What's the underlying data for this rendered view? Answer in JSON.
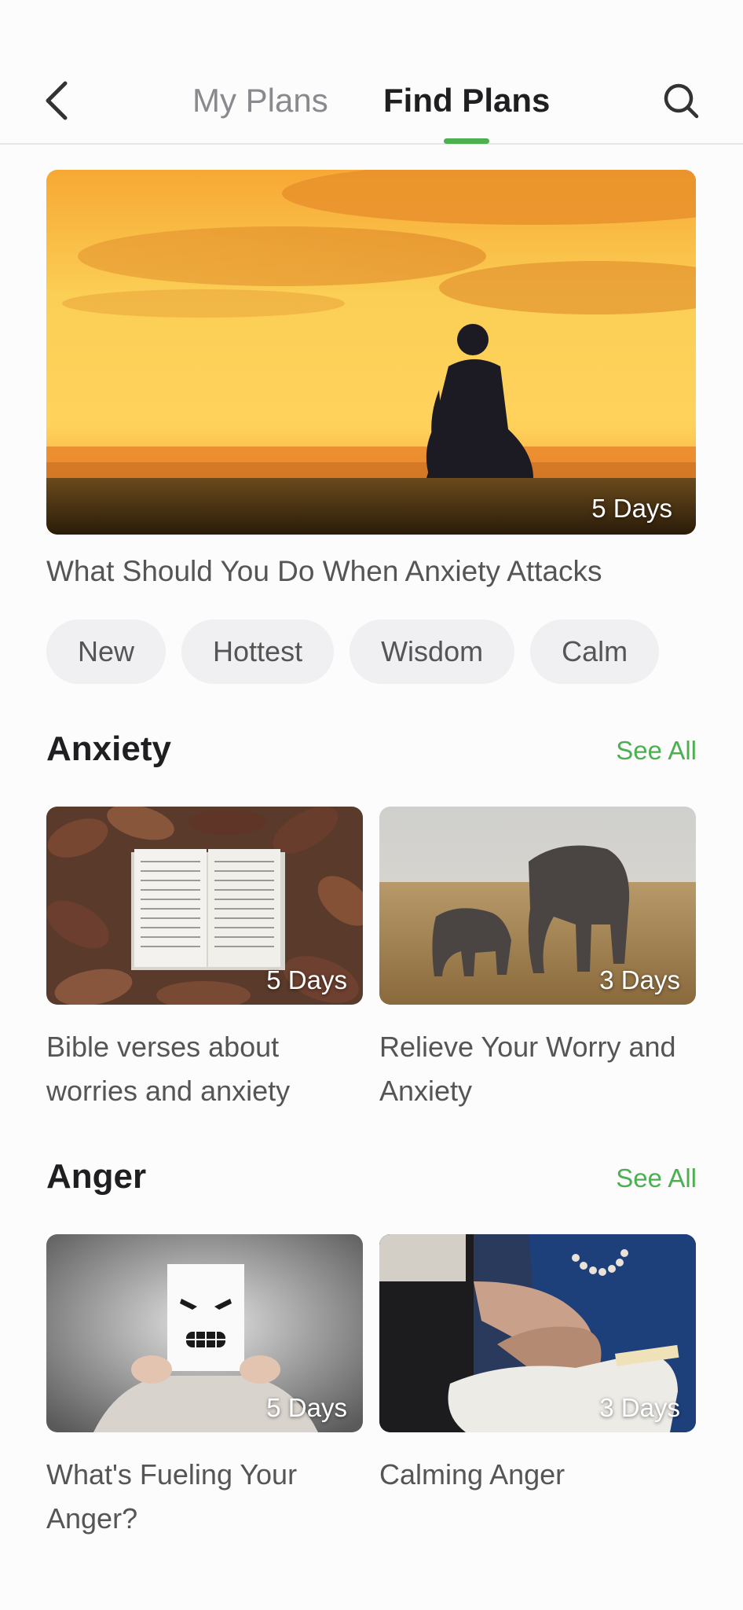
{
  "header": {
    "tabs": [
      {
        "label": "My Plans",
        "active": false
      },
      {
        "label": "Find Plans",
        "active": true
      }
    ],
    "accent_color": "#4caf50"
  },
  "featured": {
    "days": "5 Days",
    "title": "What Should You Do When Anxiety Attacks"
  },
  "chips": [
    "New",
    "Hottest",
    "Wisdom",
    "Calm"
  ],
  "sections": [
    {
      "title": "Anxiety",
      "see_all": "See All",
      "cards": [
        {
          "days": "5 Days",
          "title": "Bible verses about worries and anxiety"
        },
        {
          "days": "3 Days",
          "title": "Relieve Your Worry and Anxiety"
        }
      ]
    },
    {
      "title": "Anger",
      "see_all": "See All",
      "cards": [
        {
          "days": "5 Days",
          "title": "What's Fueling Your Anger?"
        },
        {
          "days": "3 Days",
          "title": "Calming Anger"
        }
      ]
    }
  ]
}
